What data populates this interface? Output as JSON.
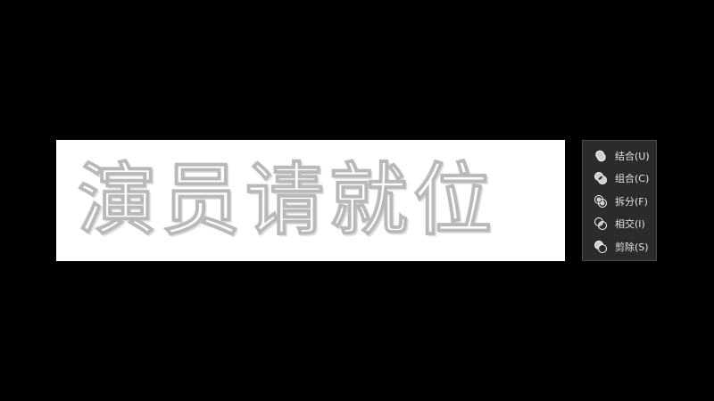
{
  "canvas": {
    "text": "演员请就位"
  },
  "shape_merge_menu": {
    "items": [
      {
        "label": "结合(U)",
        "icon": "union-icon"
      },
      {
        "label": "组合(C)",
        "icon": "combine-icon"
      },
      {
        "label": "拆分(F)",
        "icon": "fragment-icon"
      },
      {
        "label": "相交(I)",
        "icon": "intersect-icon"
      },
      {
        "label": "剪除(S)",
        "icon": "subtract-icon"
      }
    ]
  },
  "colors": {
    "background": "#000000",
    "canvas": "#ffffff",
    "menu_background": "#2b2b2b",
    "menu_text": "#e4e4e4"
  }
}
